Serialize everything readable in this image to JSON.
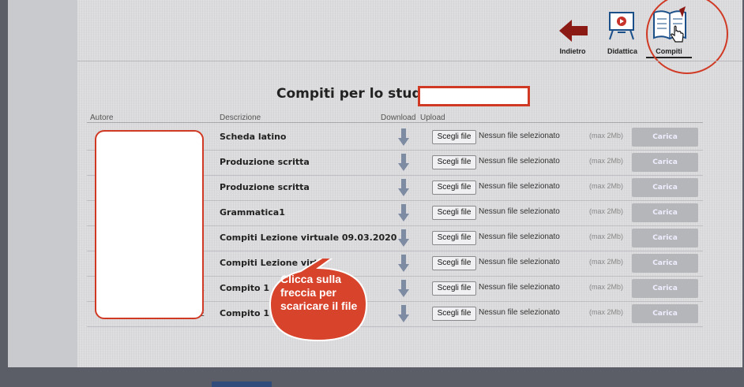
{
  "nav": {
    "back_label": "Indietro",
    "didattica_label": "Didattica",
    "compiti_label": "Compiti"
  },
  "page_title": "Compiti per lo studente",
  "table_headers": {
    "autore": "Autore",
    "descrizione": "Descrizione",
    "download": "Download",
    "upload": "Upload"
  },
  "rows": [
    {
      "description": "Scheda latino",
      "choose_label": "Scegli file",
      "no_file": "Nessun file selezionato",
      "max": "(max 2Mb)",
      "upload_label": "Carica"
    },
    {
      "description": "Produzione scritta",
      "choose_label": "Scegli file",
      "no_file": "Nessun file selezionato",
      "max": "(max 2Mb)",
      "upload_label": "Carica"
    },
    {
      "description": "Produzione scritta",
      "choose_label": "Scegli file",
      "no_file": "Nessun file selezionato",
      "max": "(max 2Mb)",
      "upload_label": "Carica"
    },
    {
      "description": "Grammatica1",
      "choose_label": "Scegli file",
      "no_file": "Nessun file selezionato",
      "max": "(max 2Mb)",
      "upload_label": "Carica"
    },
    {
      "description": "Compiti Lezione virtuale 09.03.2020",
      "choose_label": "Scegli file",
      "no_file": "Nessun file selezionato",
      "max": "(max 2Mb)",
      "upload_label": "Carica"
    },
    {
      "description": "Compiti Lezione virt",
      "choose_label": "Scegli file",
      "no_file": "Nessun file selezionato",
      "max": "(max 2Mb)",
      "upload_label": "Carica"
    },
    {
      "description": "Compito 1",
      "edge": "E",
      "choose_label": "Scegli file",
      "no_file": "Nessun file selezionato",
      "max": "(max 2Mb)",
      "upload_label": "Carica"
    },
    {
      "description": "Compito 1",
      "edge": "E",
      "choose_label": "Scegli file",
      "no_file": "Nessun file selezionato",
      "max": "(max 2Mb)",
      "upload_label": "Carica"
    }
  ],
  "callout": {
    "line1": "Clicca sulla",
    "line2": "freccia per",
    "line3": "scaricare il file"
  },
  "colors": {
    "highlight_red": "#d03a24",
    "download_arrow": "#7d8ba3",
    "back_arrow": "#8b1a14"
  },
  "icons": [
    "back-arrow-icon",
    "didattica-board-icon",
    "compiti-book-icon",
    "hand-pointer-icon",
    "download-arrow-icon"
  ]
}
